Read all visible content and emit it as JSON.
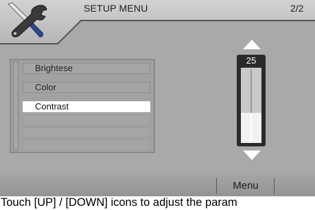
{
  "header": {
    "title": "SETUP MENU",
    "page_indicator": "2/2",
    "icon": "tools-icon"
  },
  "menu": {
    "items": [
      {
        "label": "Brightese",
        "selected": false
      },
      {
        "label": "Color",
        "selected": false
      },
      {
        "label": "Contrast",
        "selected": true
      }
    ],
    "empty_rows": 3
  },
  "slider": {
    "value": "25",
    "up_icon": "up-arrow-icon",
    "down_icon": "down-arrow-icon",
    "level_fraction": 0.4
  },
  "bottom_bar": {
    "menu_label": "Menu"
  },
  "instruction": "Touch [UP] / [DOWN] icons to adjust the param",
  "colors": {
    "screen_bg": "#a9a9a9",
    "header_bg": "#c7c7c7",
    "selected_bg": "#ffffff",
    "slider_bg": "#2a2a2a"
  }
}
